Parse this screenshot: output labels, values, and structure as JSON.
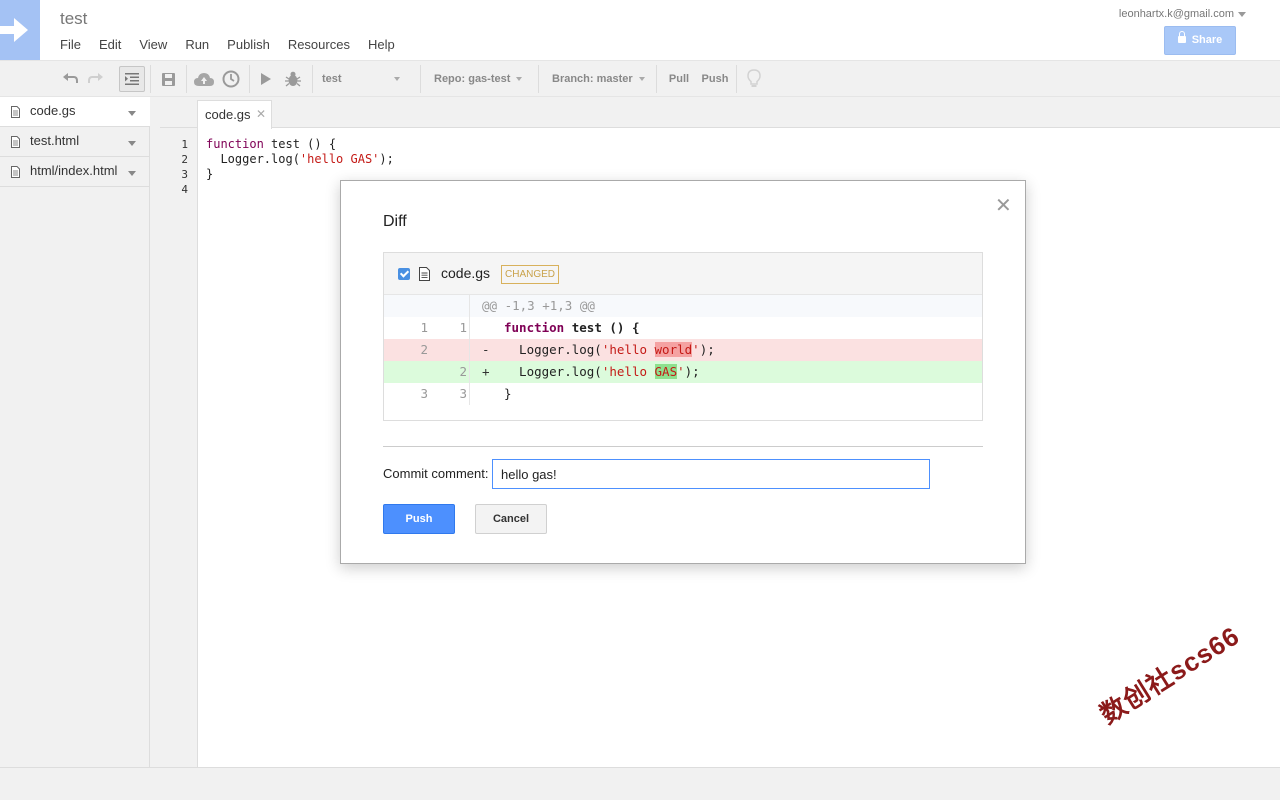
{
  "header": {
    "title": "test",
    "menus": [
      "File",
      "Edit",
      "View",
      "Run",
      "Publish",
      "Resources",
      "Help"
    ],
    "user_email": "leonhartx.k@gmail.com",
    "share_label": "Share"
  },
  "toolbar": {
    "function_select": "test",
    "repo_select": "Repo: gas-test",
    "branch_select": "Branch: master",
    "pull_label": "Pull",
    "push_label": "Push"
  },
  "sidebar": {
    "files": [
      {
        "name": "code.gs"
      },
      {
        "name": "test.html"
      },
      {
        "name": "html/index.html"
      }
    ]
  },
  "editor": {
    "tab_label": "code.gs",
    "line_numbers": [
      "1",
      "2",
      "3",
      "4"
    ],
    "code_lines": [
      "function test () {",
      "  Logger.log('hello GAS');",
      "}",
      ""
    ]
  },
  "dialog": {
    "title": "Diff",
    "file_name": "code.gs",
    "badge": "CHANGED",
    "hunk_header": "@@ -1,3 +1,3 @@",
    "rows": [
      {
        "old": "1",
        "new": "1",
        "sign": "",
        "text": "function test () {"
      },
      {
        "old": "2",
        "new": "",
        "sign": "-",
        "text": "  Logger.log('hello world');"
      },
      {
        "old": "",
        "new": "2",
        "sign": "+",
        "text": "  Logger.log('hello GAS');"
      },
      {
        "old": "3",
        "new": "3",
        "sign": "",
        "text": "}"
      }
    ],
    "commit_label": "Commit comment:",
    "commit_value": "hello gas!",
    "push_label": "Push",
    "cancel_label": "Cancel"
  },
  "watermark": "数创社scs66"
}
